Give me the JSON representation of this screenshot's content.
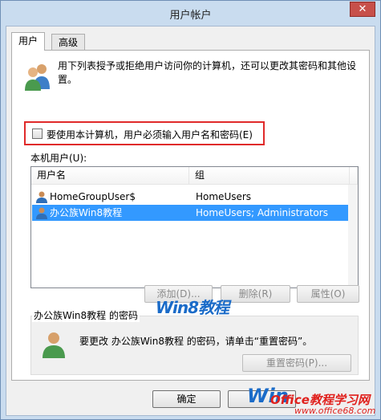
{
  "window": {
    "title": "用户帐户",
    "close_glyph": "✕"
  },
  "tabs": [
    {
      "label": "用户"
    },
    {
      "label": "高级"
    }
  ],
  "intro_text": "用下列表授予或拒绝用户访问你的计算机，还可以更改其密码和其他设置。",
  "require_password": {
    "label": "要使用本计算机，用户必须输入用户名和密码(E)",
    "checked": false
  },
  "local_users_label": "本机用户(U):",
  "users_table": {
    "columns": [
      "用户名",
      "组"
    ],
    "rows": [
      {
        "name": "HomeGroupUser$",
        "group": "HomeUsers",
        "selected": false
      },
      {
        "name": "办公族Win8教程",
        "group": "HomeUsers; Administrators",
        "selected": true
      }
    ]
  },
  "buttons": {
    "add": "添加(D)...",
    "delete": "删除(R)",
    "properties": "属性(O)",
    "reset_password": "重置密码(P)...",
    "ok": "确定"
  },
  "password_group": {
    "title": "办公族Win8教程 的密码",
    "text": "要更改 办公族Win8教程 的密码，请单击“重置密码”。"
  },
  "watermarks": {
    "center": "Win8教程",
    "bottom_logo": "Win",
    "bottom_site": "Office教程学习网",
    "bottom_url": "www.office68.com"
  },
  "icons": {
    "users": "users-group-icon",
    "user": "user-icon",
    "close": "close-icon"
  }
}
